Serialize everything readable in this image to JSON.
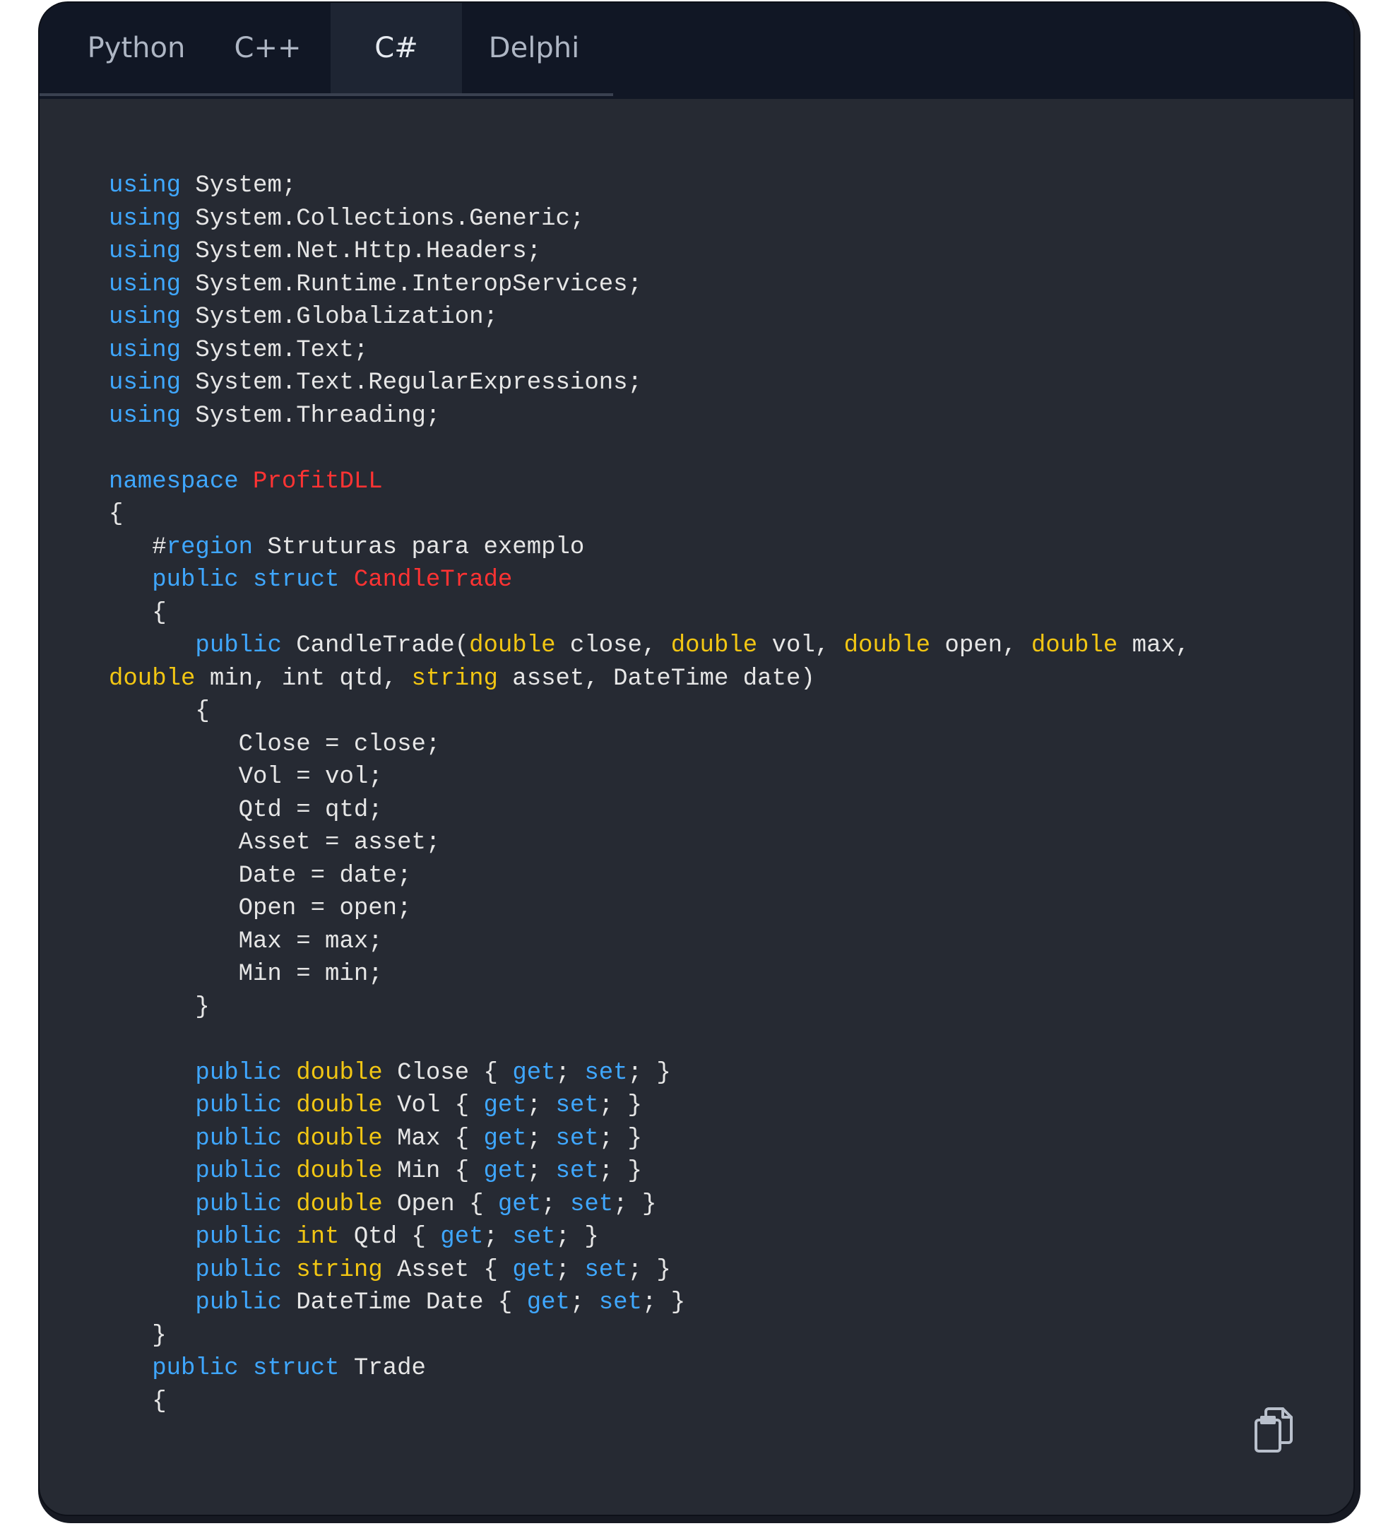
{
  "tabs": [
    {
      "label": "Python",
      "active": false
    },
    {
      "label": "C++",
      "active": false
    },
    {
      "label": "C#",
      "active": true
    },
    {
      "label": "Delphi",
      "active": false
    }
  ],
  "colors": {
    "keyword": "#3fa7ff",
    "type": "#f2c613",
    "class_name": "#ff3333",
    "text": "#e6e6e6",
    "background": "#262a33",
    "tabbar": "#111725"
  },
  "copy_icon": "clipboard-copy-icon",
  "code_lines": [
    [
      [
        "kw",
        "using"
      ],
      [
        "t",
        " System;"
      ]
    ],
    [
      [
        "kw",
        "using"
      ],
      [
        "t",
        " System.Collections.Generic;"
      ]
    ],
    [
      [
        "kw",
        "using"
      ],
      [
        "t",
        " System.Net.Http.Headers;"
      ]
    ],
    [
      [
        "kw",
        "using"
      ],
      [
        "t",
        " System.Runtime.InteropServices;"
      ]
    ],
    [
      [
        "kw",
        "using"
      ],
      [
        "t",
        " System.Globalization;"
      ]
    ],
    [
      [
        "kw",
        "using"
      ],
      [
        "t",
        " System.Text;"
      ]
    ],
    [
      [
        "kw",
        "using"
      ],
      [
        "t",
        " System.Text.RegularExpressions;"
      ]
    ],
    [
      [
        "kw",
        "using"
      ],
      [
        "t",
        " System.Threading;"
      ]
    ],
    [],
    [
      [
        "kw",
        "namespace"
      ],
      [
        "t",
        " "
      ],
      [
        "cl",
        "ProfitDLL"
      ]
    ],
    [
      [
        "t",
        "{"
      ]
    ],
    [
      [
        "t",
        "   #"
      ],
      [
        "kw",
        "region"
      ],
      [
        "t",
        " Struturas para exemplo"
      ]
    ],
    [
      [
        "t",
        "   "
      ],
      [
        "kw",
        "public"
      ],
      [
        "t",
        " "
      ],
      [
        "kw",
        "struct"
      ],
      [
        "t",
        " "
      ],
      [
        "cl",
        "CandleTrade"
      ]
    ],
    [
      [
        "t",
        "   {"
      ]
    ],
    [
      [
        "t",
        "      "
      ],
      [
        "kw",
        "public"
      ],
      [
        "t",
        " CandleTrade("
      ],
      [
        "ty",
        "double"
      ],
      [
        "t",
        " close, "
      ],
      [
        "ty",
        "double"
      ],
      [
        "t",
        " vol, "
      ],
      [
        "ty",
        "double"
      ],
      [
        "t",
        " open, "
      ],
      [
        "ty",
        "double"
      ],
      [
        "t",
        " max,"
      ]
    ],
    [
      [
        "ty",
        "double"
      ],
      [
        "t",
        " min, int qtd, "
      ],
      [
        "ty",
        "string"
      ],
      [
        "t",
        " asset, DateTime date)"
      ]
    ],
    [
      [
        "t",
        "      {"
      ]
    ],
    [
      [
        "t",
        "         Close = close;"
      ]
    ],
    [
      [
        "t",
        "         Vol = vol;"
      ]
    ],
    [
      [
        "t",
        "         Qtd = qtd;"
      ]
    ],
    [
      [
        "t",
        "         Asset = asset;"
      ]
    ],
    [
      [
        "t",
        "         Date = date;"
      ]
    ],
    [
      [
        "t",
        "         Open = open;"
      ]
    ],
    [
      [
        "t",
        "         Max = max;"
      ]
    ],
    [
      [
        "t",
        "         Min = min;"
      ]
    ],
    [
      [
        "t",
        "      }"
      ]
    ],
    [],
    [
      [
        "t",
        "      "
      ],
      [
        "kw",
        "public"
      ],
      [
        "t",
        " "
      ],
      [
        "ty",
        "double"
      ],
      [
        "t",
        " Close { "
      ],
      [
        "kw",
        "get"
      ],
      [
        "t",
        "; "
      ],
      [
        "kw",
        "set"
      ],
      [
        "t",
        "; }"
      ]
    ],
    [
      [
        "t",
        "      "
      ],
      [
        "kw",
        "public"
      ],
      [
        "t",
        " "
      ],
      [
        "ty",
        "double"
      ],
      [
        "t",
        " Vol { "
      ],
      [
        "kw",
        "get"
      ],
      [
        "t",
        "; "
      ],
      [
        "kw",
        "set"
      ],
      [
        "t",
        "; }"
      ]
    ],
    [
      [
        "t",
        "      "
      ],
      [
        "kw",
        "public"
      ],
      [
        "t",
        " "
      ],
      [
        "ty",
        "double"
      ],
      [
        "t",
        " Max { "
      ],
      [
        "kw",
        "get"
      ],
      [
        "t",
        "; "
      ],
      [
        "kw",
        "set"
      ],
      [
        "t",
        "; }"
      ]
    ],
    [
      [
        "t",
        "      "
      ],
      [
        "kw",
        "public"
      ],
      [
        "t",
        " "
      ],
      [
        "ty",
        "double"
      ],
      [
        "t",
        " Min { "
      ],
      [
        "kw",
        "get"
      ],
      [
        "t",
        "; "
      ],
      [
        "kw",
        "set"
      ],
      [
        "t",
        "; }"
      ]
    ],
    [
      [
        "t",
        "      "
      ],
      [
        "kw",
        "public"
      ],
      [
        "t",
        " "
      ],
      [
        "ty",
        "double"
      ],
      [
        "t",
        " Open { "
      ],
      [
        "kw",
        "get"
      ],
      [
        "t",
        "; "
      ],
      [
        "kw",
        "set"
      ],
      [
        "t",
        "; }"
      ]
    ],
    [
      [
        "t",
        "      "
      ],
      [
        "kw",
        "public"
      ],
      [
        "t",
        " "
      ],
      [
        "ty",
        "int"
      ],
      [
        "t",
        " Qtd { "
      ],
      [
        "kw",
        "get"
      ],
      [
        "t",
        "; "
      ],
      [
        "kw",
        "set"
      ],
      [
        "t",
        "; }"
      ]
    ],
    [
      [
        "t",
        "      "
      ],
      [
        "kw",
        "public"
      ],
      [
        "t",
        " "
      ],
      [
        "ty",
        "string"
      ],
      [
        "t",
        " Asset { "
      ],
      [
        "kw",
        "get"
      ],
      [
        "t",
        "; "
      ],
      [
        "kw",
        "set"
      ],
      [
        "t",
        "; }"
      ]
    ],
    [
      [
        "t",
        "      "
      ],
      [
        "kw",
        "public"
      ],
      [
        "t",
        " DateTime Date { "
      ],
      [
        "kw",
        "get"
      ],
      [
        "t",
        "; "
      ],
      [
        "kw",
        "set"
      ],
      [
        "t",
        "; }"
      ]
    ],
    [
      [
        "t",
        "   }"
      ]
    ],
    [
      [
        "t",
        "   "
      ],
      [
        "kw",
        "public"
      ],
      [
        "t",
        " "
      ],
      [
        "kw",
        "struct"
      ],
      [
        "t",
        " Trade"
      ]
    ],
    [
      [
        "t",
        "   {"
      ]
    ]
  ]
}
